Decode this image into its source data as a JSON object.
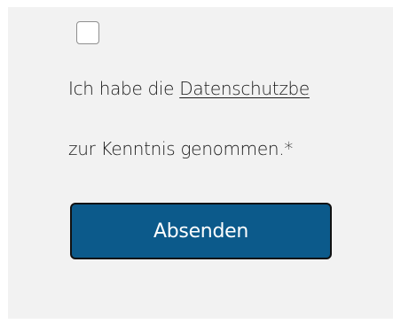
{
  "consent": {
    "checked": false,
    "text_before_link": "Ich habe die ",
    "link_text": "Datenschutzbe",
    "text_line_2": "zur Kenntnis genommen.*"
  },
  "form": {
    "submit_label": "Absenden"
  },
  "colors": {
    "panel_background": "#f2f2f2",
    "button_background": "#0c5a8b",
    "button_text": "#ffffff"
  }
}
